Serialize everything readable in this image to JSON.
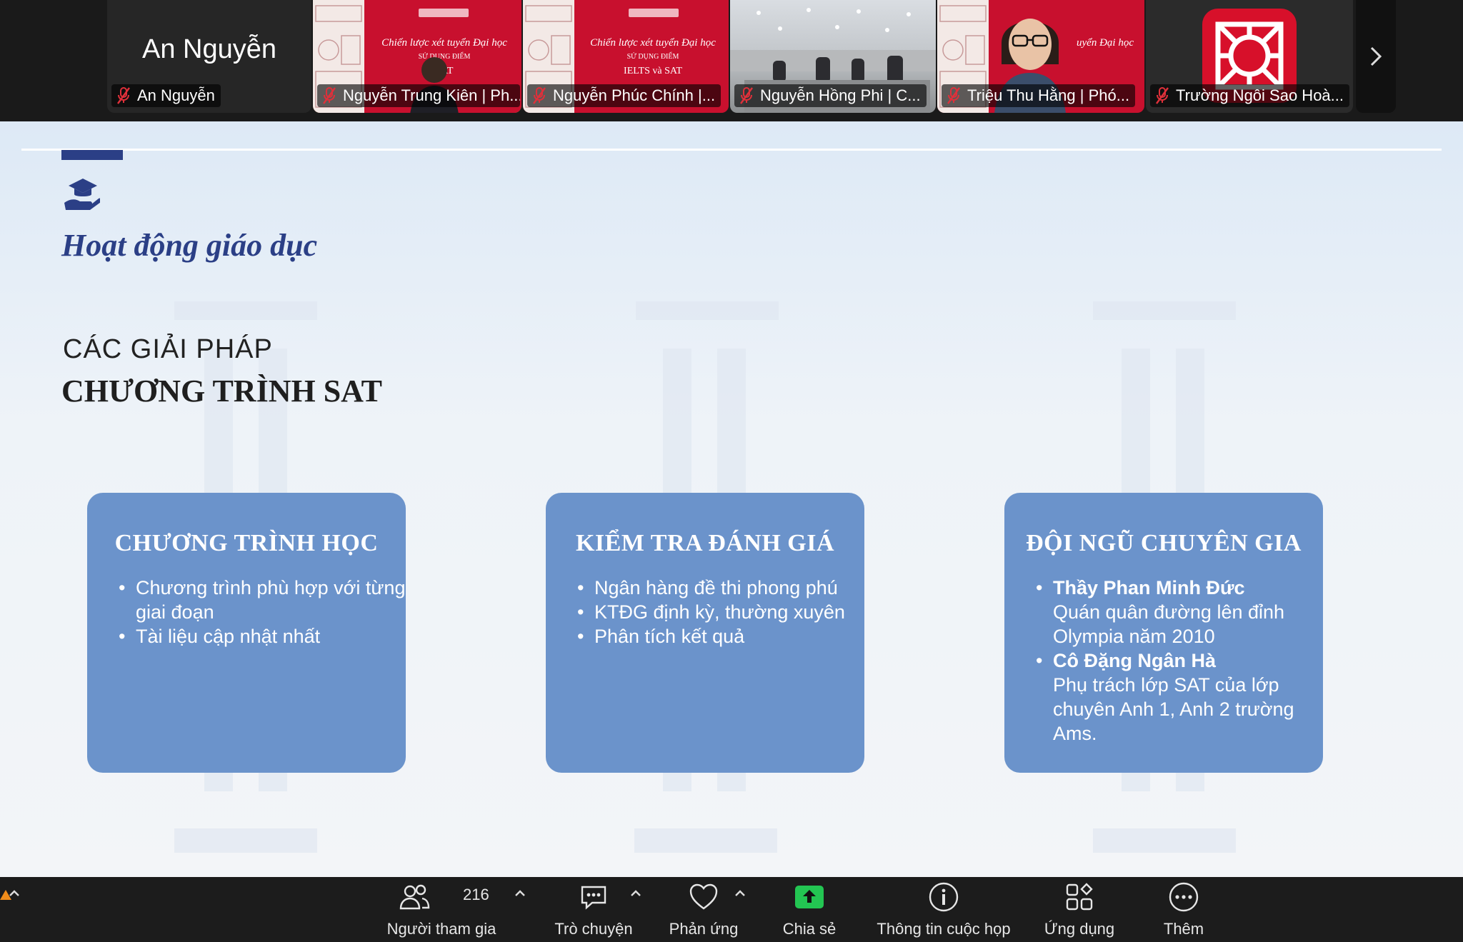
{
  "participants": [
    {
      "name": "An Nguyễn",
      "display": "An Nguyễn",
      "muted": true
    },
    {
      "name": "Nguyễn Trung Kiên | Ph...",
      "muted": true,
      "active": true
    },
    {
      "name": "Nguyễn Phúc Chính |...",
      "muted": true
    },
    {
      "name": "Nguyễn Hồng Phi | C...",
      "muted": true
    },
    {
      "name": "Triệu Thu Hằng | Phó...",
      "muted": true
    },
    {
      "name": "Trường Ngôi Sao Hoà...",
      "muted": true
    }
  ],
  "thumb_slide": {
    "line1": "Chiến lược xét tuyển Đại học",
    "line2": "SỬ DỤNG ĐIỂM",
    "line3": "IELTS và SAT",
    "line3b": "SAT"
  },
  "slide": {
    "title": "Hoạt động giáo dục",
    "sub1": "CÁC GIẢI PHÁP",
    "sub2": "CHƯƠNG TRÌNH SAT",
    "cards": [
      {
        "heading": "CHƯƠNG TRÌNH HỌC",
        "items": [
          "Chương trình phù hợp với từng giai đoạn",
          "Tài liệu cập nhật nhất"
        ]
      },
      {
        "heading": "KIỂM TRA ĐÁNH GIÁ",
        "items": [
          "Ngân hàng đề thi phong phú",
          "KTĐG định kỳ, thường xuyên",
          "Phân tích kết quả"
        ]
      },
      {
        "heading": "ĐỘI NGŨ CHUYÊN GIA",
        "experts": [
          {
            "name": "Thầy Phan Minh Đức",
            "desc": "Quán quân đường lên đỉnh Olympia năm 2010"
          },
          {
            "name": "Cô Đặng Ngân Hà",
            "desc": "Phụ trách lớp SAT của lớp chuyên Anh 1, Anh 2 trường Ams."
          }
        ]
      }
    ]
  },
  "toolbar": {
    "participants_label": "Người tham gia",
    "participants_count": "216",
    "chat_label": "Trò chuyện",
    "reactions_label": "Phản ứng",
    "share_label": "Chia sẻ",
    "meeting_info_label": "Thông tin cuộc họp",
    "apps_label": "Ứng dụng",
    "more_label": "Thêm"
  },
  "colors": {
    "share_green": "#23c552",
    "card_blue": "#6b93cb",
    "title_navy": "#2b3f86",
    "brand_red": "#d7102a",
    "active_border": "#3ecf3e"
  }
}
